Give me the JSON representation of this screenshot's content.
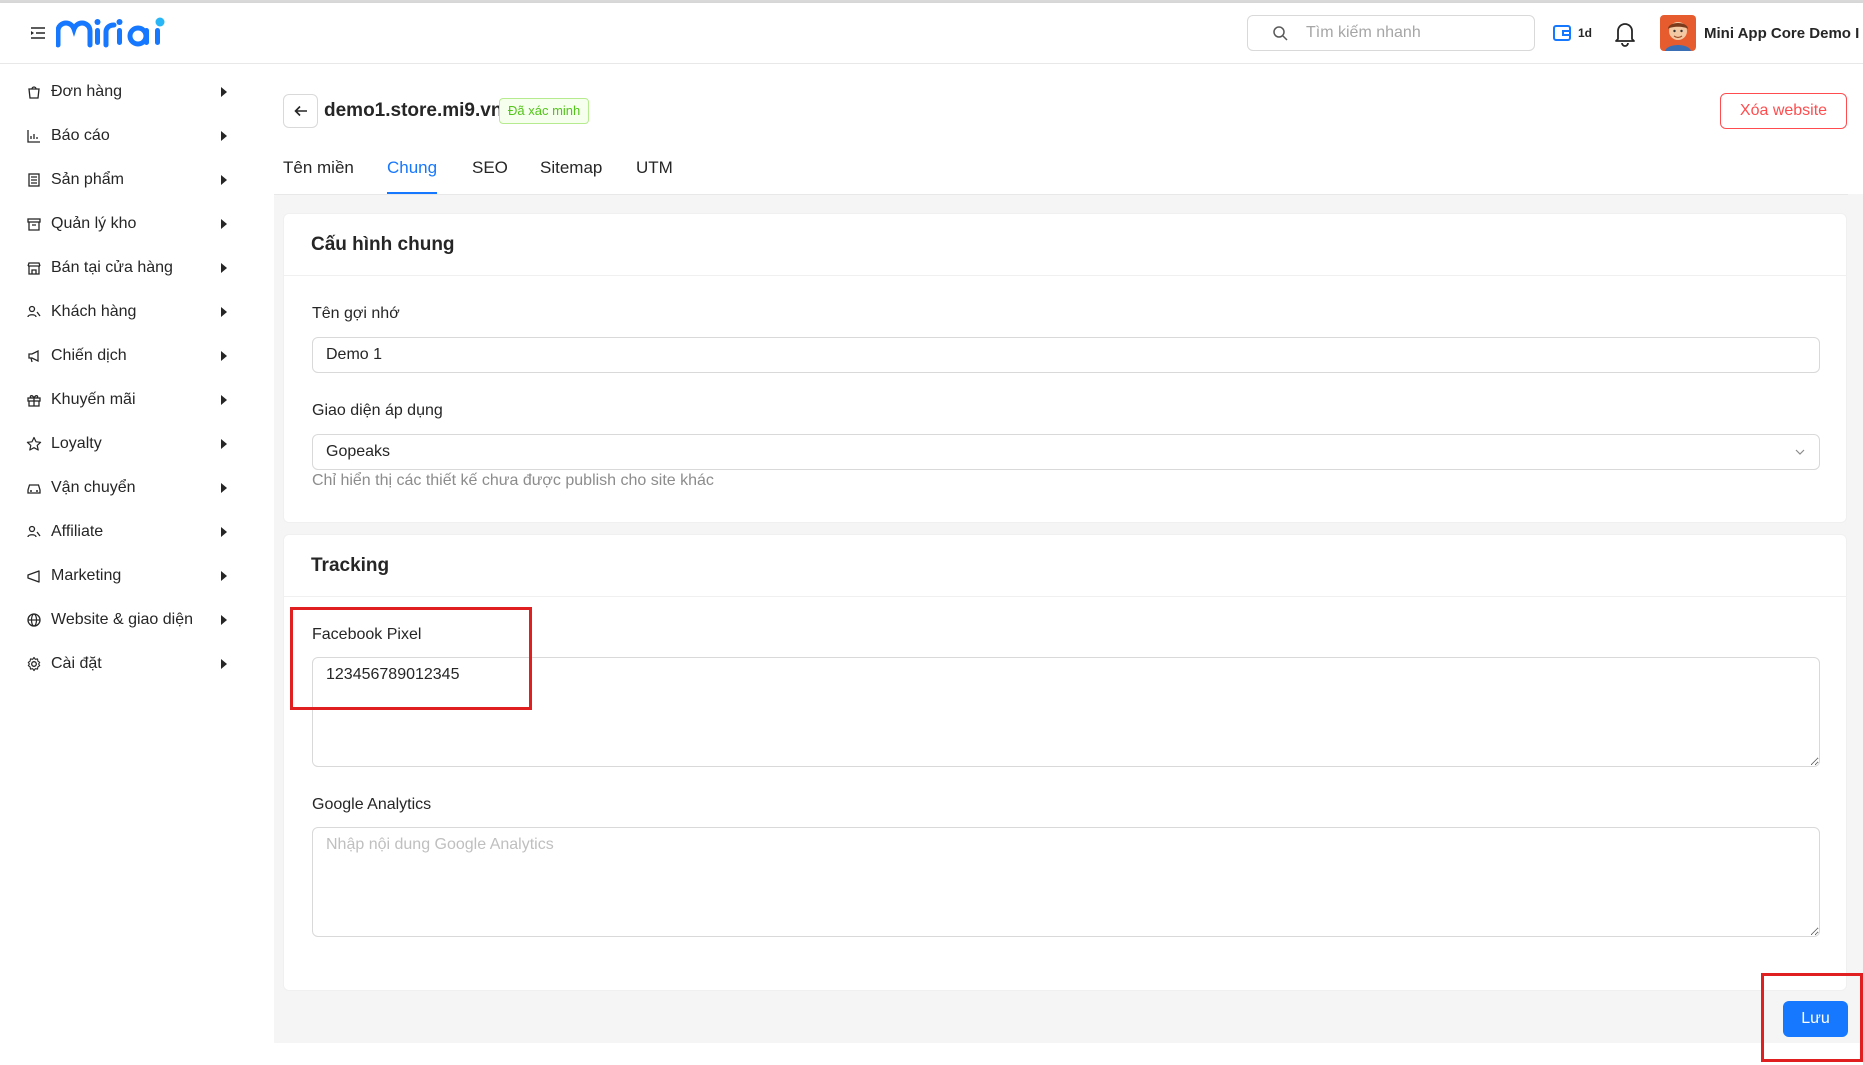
{
  "header": {
    "search_placeholder": "Tìm kiếm nhanh",
    "plan_label": "1d",
    "user_name": "Mini App Core Demo I"
  },
  "sidebar": {
    "items": [
      {
        "label": "Đơn hàng",
        "icon": "shopping-bag-icon"
      },
      {
        "label": "Báo cáo",
        "icon": "chart-icon"
      },
      {
        "label": "Sản phẩm",
        "icon": "list-icon"
      },
      {
        "label": "Quản lý kho",
        "icon": "archive-icon"
      },
      {
        "label": "Bán tại cửa hàng",
        "icon": "store-icon"
      },
      {
        "label": "Khách hàng",
        "icon": "users-icon"
      },
      {
        "label": "Chiến dịch",
        "icon": "megaphone-icon"
      },
      {
        "label": "Khuyến mãi",
        "icon": "gift-icon"
      },
      {
        "label": "Loyalty",
        "icon": "star-icon"
      },
      {
        "label": "Vận chuyển",
        "icon": "car-icon"
      },
      {
        "label": "Affiliate",
        "icon": "users-icon"
      },
      {
        "label": "Marketing",
        "icon": "megaphone-icon"
      },
      {
        "label": "Website & giao diện",
        "icon": "globe-icon"
      },
      {
        "label": "Cài đặt",
        "icon": "gear-icon"
      }
    ]
  },
  "page": {
    "site_name": "demo1.store.mi9.vn",
    "verified_badge": "Đã xác minh",
    "delete_label": "Xóa website",
    "tabs": [
      "Tên miền",
      "Chung",
      "SEO",
      "Sitemap",
      "UTM"
    ],
    "active_tab": "Chung"
  },
  "general": {
    "title": "Cấu hình chung",
    "nickname_label": "Tên gợi nhớ",
    "nickname_value": "Demo 1",
    "theme_label": "Giao diện áp dụng",
    "theme_value": "Gopeaks",
    "theme_help": "Chỉ hiển thị các thiết kế chưa được publish cho site khác"
  },
  "tracking": {
    "title": "Tracking",
    "fb_label": "Facebook Pixel",
    "fb_value": "123456789012345",
    "ga_label": "Google Analytics",
    "ga_placeholder": "Nhập nội dung Google Analytics"
  },
  "footer": {
    "save_label": "Lưu"
  },
  "colors": {
    "primary": "#1677ff",
    "danger": "#ff4d4f",
    "success": "#52c41a",
    "highlight": "#e02020"
  }
}
